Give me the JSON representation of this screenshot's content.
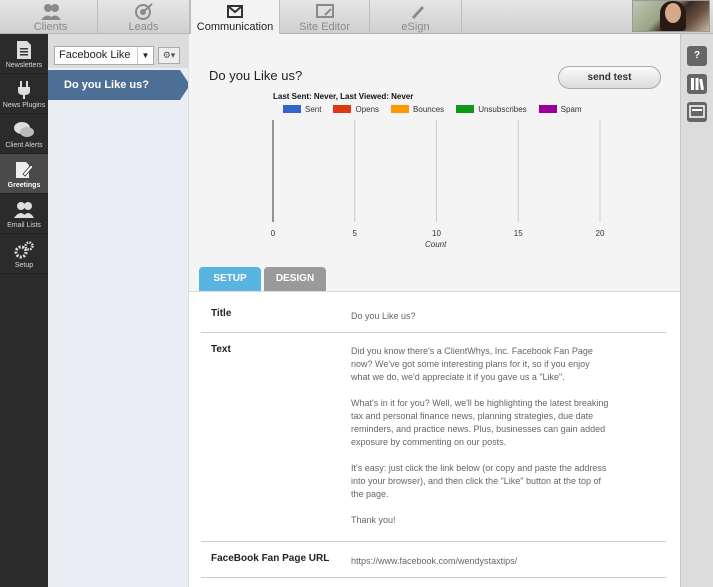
{
  "top_tabs": [
    {
      "label": "Clients",
      "icon": "clients-icon"
    },
    {
      "label": "Leads",
      "icon": "leads-icon"
    },
    {
      "label": "Communication",
      "icon": "communication-icon"
    },
    {
      "label": "Site Editor",
      "icon": "site-editor-icon"
    },
    {
      "label": "eSign",
      "icon": "esign-icon"
    }
  ],
  "left_nav": [
    {
      "label": "Newsletters",
      "icon": "newsletter-icon"
    },
    {
      "label": "News Plugins",
      "icon": "plugin-icon"
    },
    {
      "label": "Client Alerts",
      "icon": "alerts-icon"
    },
    {
      "label": "Greetings",
      "icon": "greetings-icon"
    },
    {
      "label": "Email Lists",
      "icon": "email-lists-icon"
    },
    {
      "label": "Setup",
      "icon": "setup-icon"
    }
  ],
  "list": {
    "select_value": "Facebook Like",
    "gear_label": "⚙▾",
    "items": [
      {
        "label": "Do you Like us?"
      }
    ]
  },
  "message": {
    "title": "Do you Like us?",
    "send_test_label": "send test",
    "last_sent_info": "Last Sent: Never, Last Viewed: Never"
  },
  "chart_data": {
    "type": "bar",
    "series": [
      {
        "name": "Sent",
        "color": "#3366cc",
        "values": []
      },
      {
        "name": "Opens",
        "color": "#dc3912",
        "values": []
      },
      {
        "name": "Bounces",
        "color": "#ff9900",
        "values": []
      },
      {
        "name": "Unsubscribes",
        "color": "#109618",
        "values": []
      },
      {
        "name": "Spam",
        "color": "#990099",
        "values": []
      }
    ],
    "xlabel": "Count",
    "xlim": [
      0,
      20
    ],
    "xticks": [
      0,
      5,
      10,
      15,
      20
    ],
    "legend": "top",
    "grid": true
  },
  "tabs": [
    {
      "label": "SETUP",
      "active": true
    },
    {
      "label": "DESIGN",
      "active": false
    }
  ],
  "form": {
    "title_label": "Title",
    "title_value": "Do you Like us?",
    "text_label": "Text",
    "text_paragraphs": [
      "Did you know there's a ClientWhys, Inc. Facebook Fan Page now? We've got some interesting plans for it, so if you enjoy what we do, we'd appreciate it if you gave us a \"Like\".",
      "What's in it for you? Well, we'll be highlighting the latest breaking tax and personal finance news, planning strategies, due date reminders, and practice news. Plus, businesses can gain added exposure by commenting on our posts.",
      "It's easy: just click the link below (or copy and paste the address into your browser), and then click the \"Like\" button at the top of the page.",
      "Thank you!"
    ],
    "url_label": "FaceBook Fan Page URL",
    "url_value": "https://www.facebook.com/wendystaxtips/"
  },
  "right_bar": [
    {
      "label": "?",
      "icon": "help-icon"
    },
    {
      "label": "",
      "icon": "library-icon"
    },
    {
      "label": "",
      "icon": "preview-icon"
    }
  ]
}
